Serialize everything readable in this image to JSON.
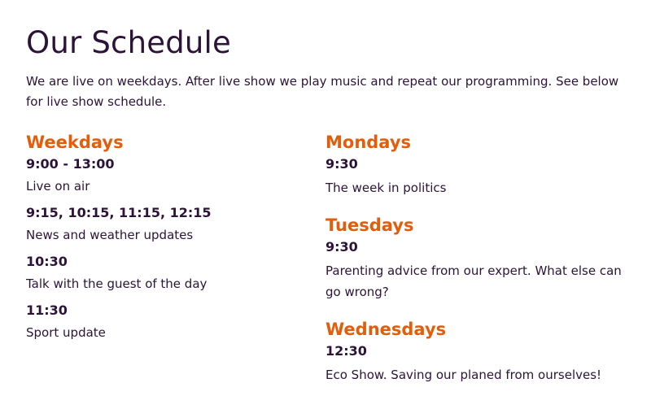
{
  "header": {
    "title": "Our Schedule",
    "intro": "We are live on weekdays. After live show we play music and repeat our programming. See below for live show schedule."
  },
  "colors": {
    "heading": "#2c1338",
    "accent": "#e35d0b",
    "text": "#2c1338",
    "background": "#ffffff"
  },
  "weekdays": {
    "heading": "Weekdays",
    "slots": [
      {
        "time": "9:00 - 13:00",
        "desc": "Live on air"
      },
      {
        "time": "9:15, 10:15, 11:15, 12:15",
        "desc": "News and weather updates"
      },
      {
        "time": "10:30",
        "desc": "Talk with the guest of the day"
      },
      {
        "time": "11:30",
        "desc": "Sport update"
      }
    ]
  },
  "days": [
    {
      "heading": "Mondays",
      "time": "9:30",
      "desc": "The week in politics"
    },
    {
      "heading": "Tuesdays",
      "time": "9:30",
      "desc": "Parenting advice from our expert. What else can go wrong?"
    },
    {
      "heading": "Wednesdays",
      "time": "12:30",
      "desc": "Eco Show. Saving our planed from ourselves!"
    }
  ]
}
